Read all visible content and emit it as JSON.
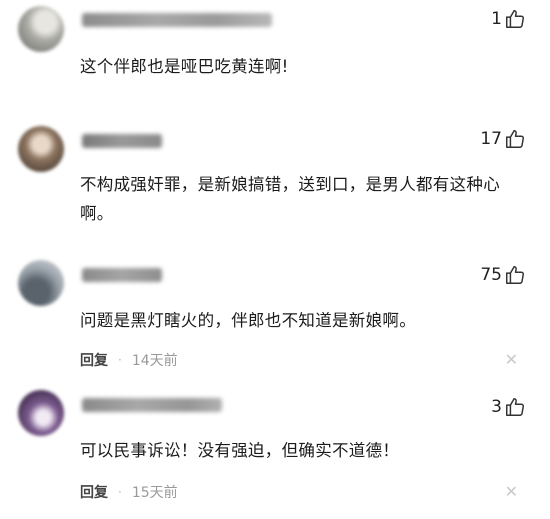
{
  "comments": [
    {
      "username": "",
      "likes": "1",
      "text": "这个伴郎也是哑巴吃黄连啊!",
      "reply_label": "",
      "time": ""
    },
    {
      "username": "",
      "likes": "17",
      "text": "不构成强奸罪，是新娘搞错，送到口，是男人都有这种心啊。",
      "reply_label": "",
      "time": ""
    },
    {
      "username": "",
      "likes": "75",
      "text": "问题是黑灯瞎火的，伴郎也不知道是新娘啊。",
      "reply_label": "回复",
      "time": "14天前"
    },
    {
      "username": "",
      "likes": "3",
      "text": "可以民事诉讼！没有强迫，但确实不道德！",
      "reply_label": "回复",
      "time": "15天前"
    }
  ],
  "icons": {
    "like": "thumbs-up-outline-icon",
    "close": "close-icon"
  },
  "colors": {
    "text": "#1b1b1b",
    "meta": "#9a9a9a",
    "avatar_1": "#8d8f89",
    "avatar_2": "#6f5d4f",
    "avatar_3": "#77808a",
    "avatar_4": "#5a3f68"
  }
}
